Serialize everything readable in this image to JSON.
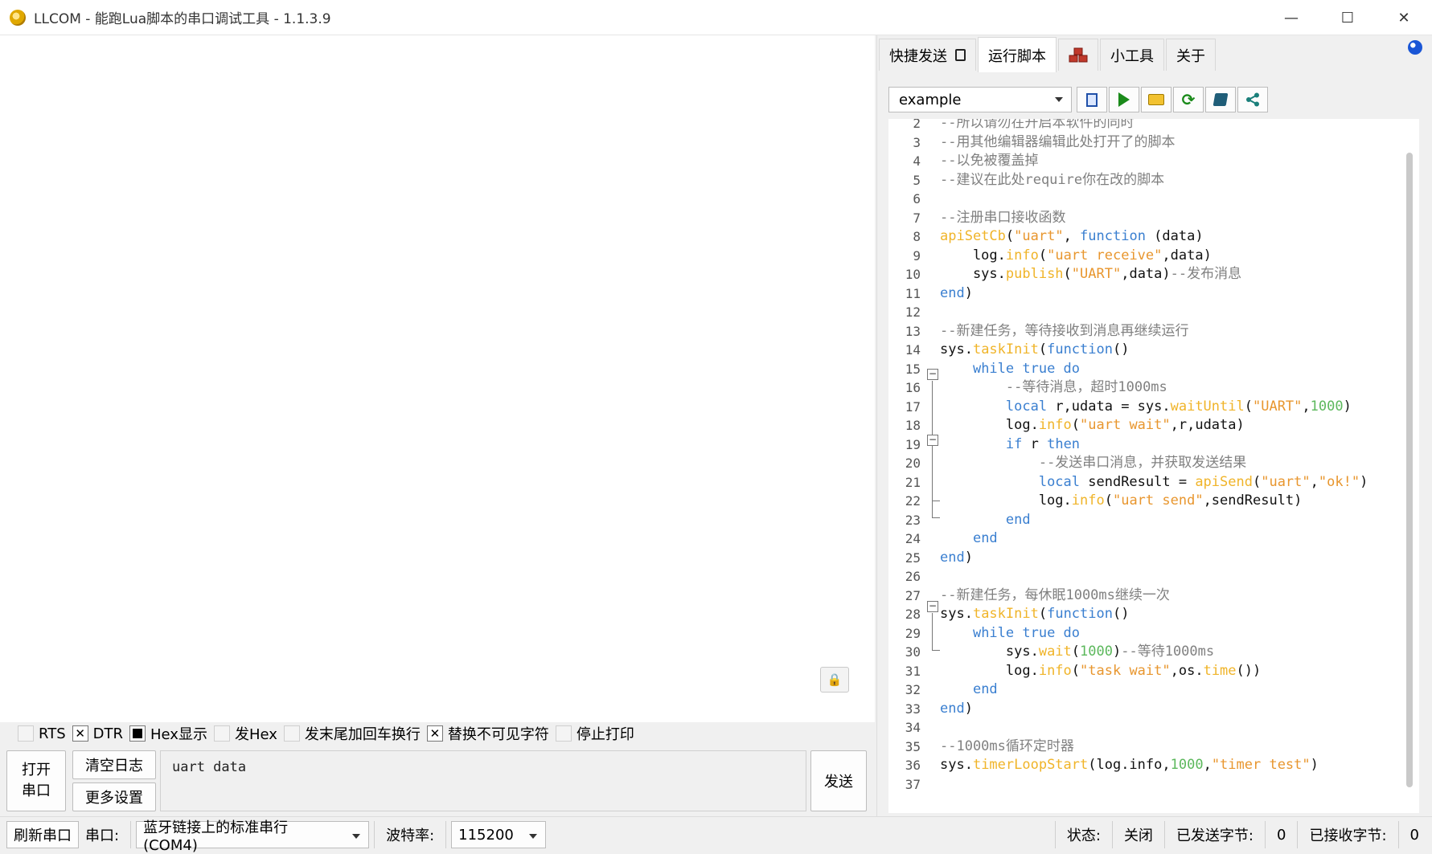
{
  "window": {
    "title": "LLCOM - 能跑Lua脚本的串口调试工具 - 1.1.3.9",
    "minimize": "—",
    "maximize": "☐",
    "close": "✕"
  },
  "checkboxes": [
    {
      "label": "RTS",
      "state": "unchecked"
    },
    {
      "label": "DTR",
      "state": "checked"
    },
    {
      "label": "Hex显示",
      "state": "filled"
    },
    {
      "label": "发Hex",
      "state": "unchecked"
    },
    {
      "label": "发末尾加回车换行",
      "state": "unchecked"
    },
    {
      "label": "替换不可见字符",
      "state": "checked"
    },
    {
      "label": "停止打印",
      "state": "unchecked"
    }
  ],
  "buttons": {
    "open_port_line1": "打开",
    "open_port_line2": "串口",
    "clear_log": "清空日志",
    "more_settings": "更多设置",
    "send": "发送"
  },
  "send_input": {
    "value": "uart data"
  },
  "tabs": [
    "快捷发送",
    "运行脚本",
    "小工具",
    "关于"
  ],
  "script": {
    "selected": "example"
  },
  "code_lines": [
    {
      "n": "2",
      "parts": [
        [
          "c-cm",
          "--所以请勿在开启本软件的同时"
        ]
      ]
    },
    {
      "n": "3",
      "parts": [
        [
          "c-cm",
          "--用其他编辑器编辑此处打开了的脚本"
        ]
      ]
    },
    {
      "n": "4",
      "parts": [
        [
          "c-cm",
          "--以免被覆盖掉"
        ]
      ]
    },
    {
      "n": "5",
      "parts": [
        [
          "c-cm",
          "--建议在此处require你在改的脚本"
        ]
      ]
    },
    {
      "n": "6",
      "parts": []
    },
    {
      "n": "7",
      "parts": [
        [
          "c-cm",
          "--注册串口接收函数"
        ]
      ]
    },
    {
      "n": "8",
      "parts": [
        [
          "c-fn",
          "apiSetCb"
        ],
        [
          "c-id",
          "("
        ],
        [
          "c-str",
          "\"uart\""
        ],
        [
          "c-id",
          ", "
        ],
        [
          "c-kw",
          "function"
        ],
        [
          "c-id",
          " (data)"
        ]
      ]
    },
    {
      "n": "9",
      "parts": [
        [
          "c-id",
          "    log."
        ],
        [
          "c-fn",
          "info"
        ],
        [
          "c-id",
          "("
        ],
        [
          "c-str",
          "\"uart receive\""
        ],
        [
          "c-id",
          ",data)"
        ]
      ]
    },
    {
      "n": "10",
      "parts": [
        [
          "c-id",
          "    sys."
        ],
        [
          "c-fn",
          "publish"
        ],
        [
          "c-id",
          "("
        ],
        [
          "c-str",
          "\"UART\""
        ],
        [
          "c-id",
          ",data)"
        ],
        [
          "c-cm",
          "--发布消息"
        ]
      ]
    },
    {
      "n": "11",
      "parts": [
        [
          "c-kw",
          "end"
        ],
        [
          "c-id",
          ")"
        ]
      ]
    },
    {
      "n": "12",
      "parts": []
    },
    {
      "n": "13",
      "parts": [
        [
          "c-cm",
          "--新建任务，等待接收到消息再继续运行"
        ]
      ]
    },
    {
      "n": "14",
      "parts": [
        [
          "c-id",
          "sys."
        ],
        [
          "c-fn",
          "taskInit"
        ],
        [
          "c-id",
          "("
        ],
        [
          "c-kw",
          "function"
        ],
        [
          "c-id",
          "()"
        ]
      ]
    },
    {
      "n": "15",
      "parts": [
        [
          "c-id",
          "    "
        ],
        [
          "c-kw",
          "while true do"
        ]
      ]
    },
    {
      "n": "16",
      "parts": [
        [
          "c-id",
          "        "
        ],
        [
          "c-cm",
          "--等待消息，超时1000ms"
        ]
      ]
    },
    {
      "n": "17",
      "parts": [
        [
          "c-id",
          "        "
        ],
        [
          "c-kw",
          "local"
        ],
        [
          "c-id",
          " r,udata = sys."
        ],
        [
          "c-fn",
          "waitUntil"
        ],
        [
          "c-id",
          "("
        ],
        [
          "c-str",
          "\"UART\""
        ],
        [
          "c-id",
          ","
        ],
        [
          "c-num",
          "1000"
        ],
        [
          "c-id",
          ")"
        ]
      ]
    },
    {
      "n": "18",
      "parts": [
        [
          "c-id",
          "        log."
        ],
        [
          "c-fn",
          "info"
        ],
        [
          "c-id",
          "("
        ],
        [
          "c-str",
          "\"uart wait\""
        ],
        [
          "c-id",
          ",r,udata)"
        ]
      ]
    },
    {
      "n": "19",
      "parts": [
        [
          "c-id",
          "        "
        ],
        [
          "c-kw",
          "if"
        ],
        [
          "c-id",
          " r "
        ],
        [
          "c-kw",
          "then"
        ]
      ]
    },
    {
      "n": "20",
      "parts": [
        [
          "c-id",
          "            "
        ],
        [
          "c-cm",
          "--发送串口消息，并获取发送结果"
        ]
      ]
    },
    {
      "n": "21",
      "parts": [
        [
          "c-id",
          "            "
        ],
        [
          "c-kw",
          "local"
        ],
        [
          "c-id",
          " sendResult = "
        ],
        [
          "c-fn",
          "apiSend"
        ],
        [
          "c-id",
          "("
        ],
        [
          "c-str",
          "\"uart\""
        ],
        [
          "c-id",
          ","
        ],
        [
          "c-str",
          "\"ok!\""
        ],
        [
          "c-id",
          ")"
        ]
      ]
    },
    {
      "n": "22",
      "parts": [
        [
          "c-id",
          "            log."
        ],
        [
          "c-fn",
          "info"
        ],
        [
          "c-id",
          "("
        ],
        [
          "c-str",
          "\"uart send\""
        ],
        [
          "c-id",
          ",sendResult)"
        ]
      ]
    },
    {
      "n": "23",
      "parts": [
        [
          "c-id",
          "        "
        ],
        [
          "c-kw",
          "end"
        ]
      ]
    },
    {
      "n": "24",
      "parts": [
        [
          "c-id",
          "    "
        ],
        [
          "c-kw",
          "end"
        ]
      ]
    },
    {
      "n": "25",
      "parts": [
        [
          "c-kw",
          "end"
        ],
        [
          "c-id",
          ")"
        ]
      ]
    },
    {
      "n": "26",
      "parts": []
    },
    {
      "n": "27",
      "parts": [
        [
          "c-cm",
          "--新建任务，每休眠1000ms继续一次"
        ]
      ]
    },
    {
      "n": "28",
      "parts": [
        [
          "c-id",
          "sys."
        ],
        [
          "c-fn",
          "taskInit"
        ],
        [
          "c-id",
          "("
        ],
        [
          "c-kw",
          "function"
        ],
        [
          "c-id",
          "()"
        ]
      ]
    },
    {
      "n": "29",
      "parts": [
        [
          "c-id",
          "    "
        ],
        [
          "c-kw",
          "while true do"
        ]
      ]
    },
    {
      "n": "30",
      "parts": [
        [
          "c-id",
          "        sys."
        ],
        [
          "c-fn",
          "wait"
        ],
        [
          "c-id",
          "("
        ],
        [
          "c-num",
          "1000"
        ],
        [
          "c-id",
          ")"
        ],
        [
          "c-cm",
          "--等待1000ms"
        ]
      ]
    },
    {
      "n": "31",
      "parts": [
        [
          "c-id",
          "        log."
        ],
        [
          "c-fn",
          "info"
        ],
        [
          "c-id",
          "("
        ],
        [
          "c-str",
          "\"task wait\""
        ],
        [
          "c-id",
          ",os."
        ],
        [
          "c-fn",
          "time"
        ],
        [
          "c-id",
          "())"
        ]
      ]
    },
    {
      "n": "32",
      "parts": [
        [
          "c-id",
          "    "
        ],
        [
          "c-kw",
          "end"
        ]
      ]
    },
    {
      "n": "33",
      "parts": [
        [
          "c-kw",
          "end"
        ],
        [
          "c-id",
          ")"
        ]
      ]
    },
    {
      "n": "34",
      "parts": []
    },
    {
      "n": "35",
      "parts": [
        [
          "c-cm",
          "--1000ms循环定时器"
        ]
      ]
    },
    {
      "n": "36",
      "parts": [
        [
          "c-id",
          "sys."
        ],
        [
          "c-fn",
          "timerLoopStart"
        ],
        [
          "c-id",
          "(log.info,"
        ],
        [
          "c-num",
          "1000"
        ],
        [
          "c-id",
          ","
        ],
        [
          "c-str",
          "\"timer test\""
        ],
        [
          "c-id",
          ")"
        ]
      ]
    },
    {
      "n": "37",
      "parts": []
    }
  ],
  "status": {
    "refresh_port": "刷新串口",
    "port_label": "串口:",
    "port_value": "蓝牙链接上的标准串行 (COM4)",
    "baud_label": "波特率:",
    "baud_value": "115200",
    "state_label": "状态:",
    "state_value": "关闭",
    "sent_label": "已发送字节:",
    "sent_value": "0",
    "recv_label": "已接收字节:",
    "recv_value": "0"
  }
}
